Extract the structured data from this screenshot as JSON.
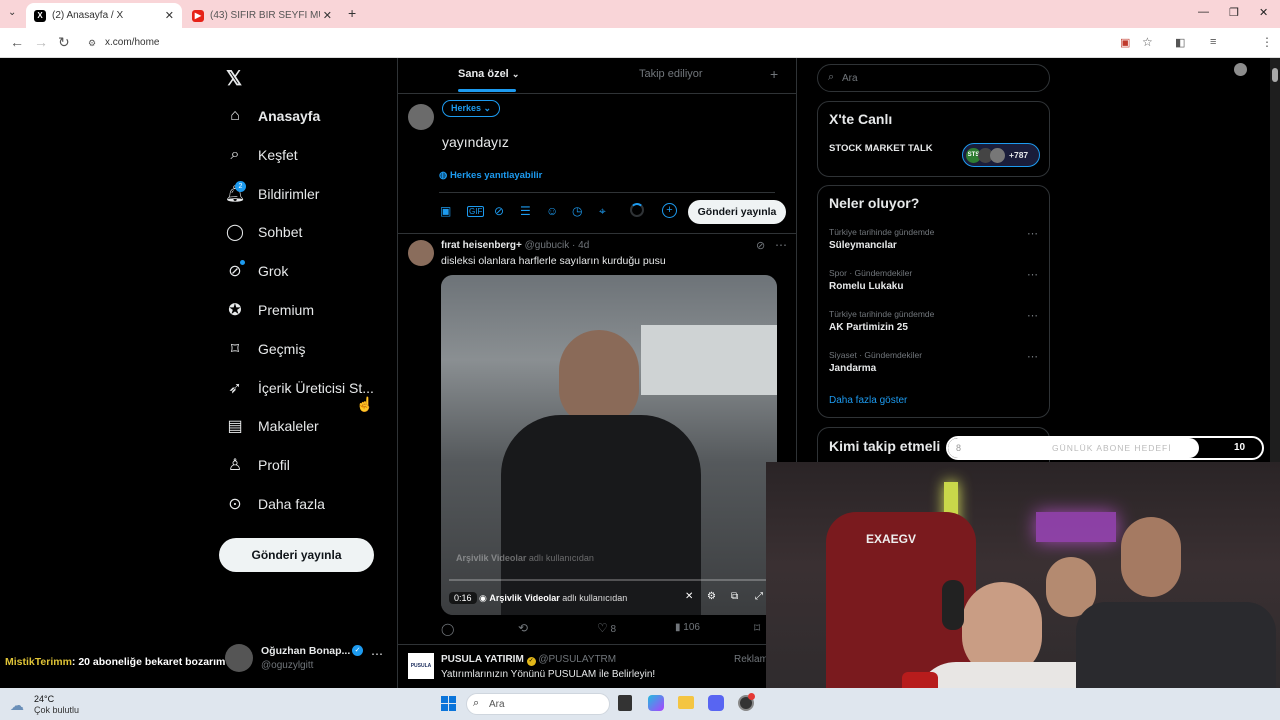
{
  "browser": {
    "tabs": [
      {
        "title": "(2) Anasayfa / X",
        "active": true
      },
      {
        "title": "(43) SIFIR BİR SEYFİ MÜZİĞİ - Yo",
        "active": false
      }
    ],
    "url": "x.com/home"
  },
  "left_nav": {
    "items": [
      {
        "label": "Anasayfa",
        "icon": "home-icon"
      },
      {
        "label": "Keşfet",
        "icon": "search-icon"
      },
      {
        "label": "Bildirimler",
        "icon": "bell-icon",
        "badge": "2"
      },
      {
        "label": "Sohbet",
        "icon": "chat-icon"
      },
      {
        "label": "Grok",
        "icon": "grok-icon"
      },
      {
        "label": "Premium",
        "icon": "verified-icon"
      },
      {
        "label": "Geçmiş",
        "icon": "bookmark-icon"
      },
      {
        "label": "İçerik Üreticisi St...",
        "icon": "rocket-icon"
      },
      {
        "label": "Makaleler",
        "icon": "article-icon"
      },
      {
        "label": "Profil",
        "icon": "person-icon"
      },
      {
        "label": "Daha fazla",
        "icon": "more-circle-icon"
      }
    ],
    "post_button": "Gönderi yayınla",
    "account": {
      "name": "Oğuzhan Bonap...",
      "handle": "@oguzylgitt"
    }
  },
  "feed": {
    "tabs": [
      "Sana özel",
      "Takip ediliyor"
    ],
    "composer": {
      "audience": "Herkes",
      "text": "yayındayız",
      "reply_setting": "Herkes yanıtlayabilir",
      "post_button": "Gönderi yayınla"
    },
    "post": {
      "author": "fırat heisenberg+",
      "handle": "@gubucik",
      "time": "4d",
      "text": "disleksi olanlara harflerle sayıların kurduğu pusu",
      "video_duration": "0:16",
      "video_source": "Arşivlik Videolar",
      "video_source_suffix": "adlı kullanıcıdan",
      "video_watermark": "Arşivlik Videolar",
      "video_watermark_suffix": "adlı kullanıcıdan",
      "likes": "8",
      "views": "106"
    },
    "ad": {
      "author": "PUSULA YATIRIM",
      "handle": "@PUSULAYTRM",
      "tag": "Reklam",
      "text": "Yatırımlarınızın Yönünü PUSULAM ile Belirleyin!",
      "logo_text": "PUSULA"
    }
  },
  "right": {
    "search_placeholder": "Ara",
    "live": {
      "title": "X'te Canlı",
      "item": "STOCK MARKET TALK",
      "count": "+787"
    },
    "trends": {
      "title": "Neler oluyor?",
      "items": [
        {
          "category": "Türkiye tarihinde gündemde",
          "name": "Süleymancılar"
        },
        {
          "category": "Spor · Gündemdekiler",
          "name": "Romelu Lukaku"
        },
        {
          "category": "Türkiye tarihinde gündemde",
          "name": "AK Partimizin 25"
        },
        {
          "category": "Siyaset · Gündemdekiler",
          "name": "Jandarma"
        }
      ],
      "show_more": "Daha fazla göster"
    },
    "who_to_follow": "Kimi takip etmeli"
  },
  "overlay": {
    "goal_label": "GÜNLÜK ABONE HEDEFİ",
    "goal_current": "8",
    "goal_target": "10",
    "goal_progress": 0.8,
    "chat_user": "MistikTerimm",
    "chat_message": ": 20 aboneliğe bekaret bozarım",
    "chair_brand": "EXAEGV"
  },
  "taskbar": {
    "weather_temp": "24°C",
    "weather_desc": "Çok bulutlu",
    "search_placeholder": "Ara"
  },
  "colors": {
    "accent": "#1d9bf0",
    "tabbar": "#f9d5d8",
    "chat_user": "#e0c437"
  }
}
